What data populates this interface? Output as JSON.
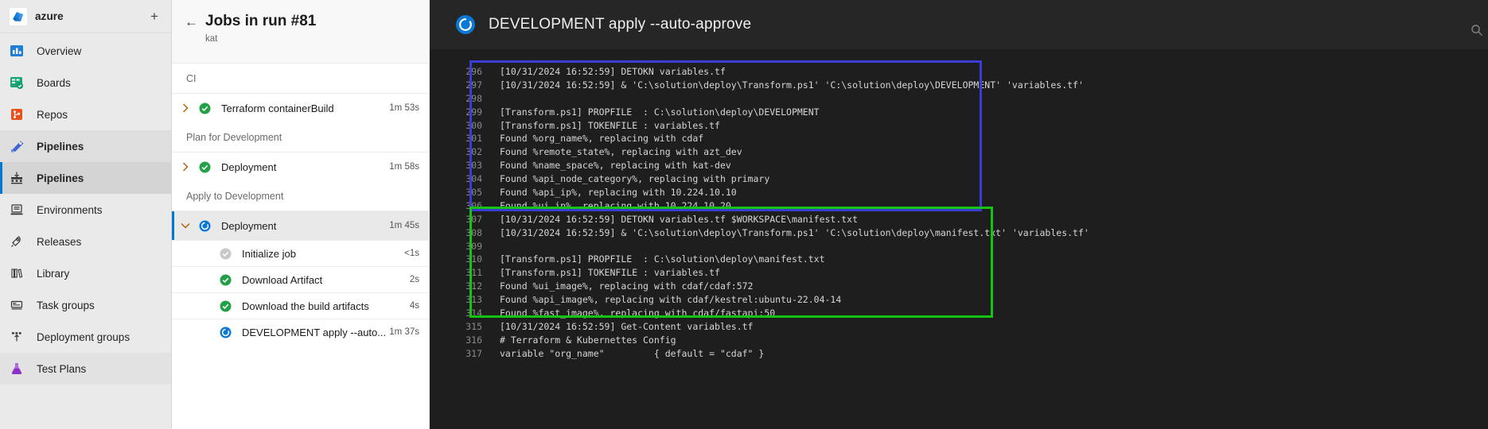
{
  "nav": {
    "org_name": "azure",
    "add_label": "+",
    "items": [
      {
        "label": "Overview",
        "icon": "overview-icon",
        "state": "normal"
      },
      {
        "label": "Boards",
        "icon": "boards-icon",
        "state": "normal"
      },
      {
        "label": "Repos",
        "icon": "repos-icon",
        "state": "normal"
      },
      {
        "label": "Pipelines",
        "icon": "pipelines-icon",
        "state": "group"
      },
      {
        "label": "Pipelines",
        "icon": "pipelines-sub-icon",
        "state": "active"
      },
      {
        "label": "Environments",
        "icon": "environments-icon",
        "state": "normal"
      },
      {
        "label": "Releases",
        "icon": "releases-icon",
        "state": "normal"
      },
      {
        "label": "Library",
        "icon": "library-icon",
        "state": "normal"
      },
      {
        "label": "Task groups",
        "icon": "task-groups-icon",
        "state": "normal"
      },
      {
        "label": "Deployment groups",
        "icon": "deployment-groups-icon",
        "state": "normal"
      },
      {
        "label": "Test Plans",
        "icon": "test-plans-icon",
        "state": "testplans"
      }
    ]
  },
  "jobs_panel": {
    "back_label": "←",
    "title": "Jobs in run #81",
    "subtitle": "kat",
    "sections": [
      {
        "stage": "CI",
        "rows": [
          {
            "kind": "job",
            "name": "Terraform containerBuild",
            "duration": "1m 53s",
            "status": "succeeded",
            "expanded": false,
            "selected": false
          }
        ]
      },
      {
        "stage": "Plan for Development",
        "rows": [
          {
            "kind": "job",
            "name": "Deployment",
            "duration": "1m 58s",
            "status": "succeeded",
            "expanded": false,
            "selected": false
          }
        ]
      },
      {
        "stage": "Apply to Development",
        "rows": [
          {
            "kind": "job",
            "name": "Deployment",
            "duration": "1m 45s",
            "status": "running",
            "expanded": true,
            "selected": true
          },
          {
            "kind": "task",
            "name": "Initialize job",
            "duration": "<1s",
            "status": "skipped"
          },
          {
            "kind": "task",
            "name": "Download Artifact",
            "duration": "2s",
            "status": "succeeded"
          },
          {
            "kind": "task",
            "name": "Download the build artifacts",
            "duration": "4s",
            "status": "succeeded"
          },
          {
            "kind": "task",
            "name": "DEVELOPMENT apply --auto...",
            "duration": "1m 37s",
            "status": "running"
          }
        ]
      }
    ]
  },
  "log_panel": {
    "title": "DEVELOPMENT apply --auto-approve",
    "status_icon": "running-spinner-icon",
    "search_icon": "search-icon",
    "lines": [
      {
        "n": "296",
        "text": "[10/31/2024 16:52:59] DETOKN variables.tf"
      },
      {
        "n": "297",
        "text": "[10/31/2024 16:52:59] & 'C:\\solution\\deploy\\Transform.ps1' 'C:\\solution\\deploy\\DEVELOPMENT' 'variables.tf'"
      },
      {
        "n": "298",
        "text": ""
      },
      {
        "n": "299",
        "text": "[Transform.ps1] PROPFILE  : C:\\solution\\deploy\\DEVELOPMENT"
      },
      {
        "n": "300",
        "text": "[Transform.ps1] TOKENFILE : variables.tf"
      },
      {
        "n": "301",
        "text": "Found %org_name%, replacing with cdaf"
      },
      {
        "n": "302",
        "text": "Found %remote_state%, replacing with azt_dev"
      },
      {
        "n": "303",
        "text": "Found %name_space%, replacing with kat-dev"
      },
      {
        "n": "304",
        "text": "Found %api_node_category%, replacing with primary"
      },
      {
        "n": "305",
        "text": "Found %api_ip%, replacing with 10.224.10.10"
      },
      {
        "n": "306",
        "text": "Found %ui_ip%, replacing with 10.224.10.20"
      },
      {
        "n": "307",
        "text": "[10/31/2024 16:52:59] DETOKN variables.tf $WORKSPACE\\manifest.txt"
      },
      {
        "n": "308",
        "text": "[10/31/2024 16:52:59] & 'C:\\solution\\deploy\\Transform.ps1' 'C:\\solution\\deploy\\manifest.txt' 'variables.tf'"
      },
      {
        "n": "309",
        "text": ""
      },
      {
        "n": "310",
        "text": "[Transform.ps1] PROPFILE  : C:\\solution\\deploy\\manifest.txt"
      },
      {
        "n": "311",
        "text": "[Transform.ps1] TOKENFILE : variables.tf"
      },
      {
        "n": "312",
        "text": "Found %ui_image%, replacing with cdaf/cdaf:572"
      },
      {
        "n": "313",
        "text": "Found %api_image%, replacing with cdaf/kestrel:ubuntu-22.04-14"
      },
      {
        "n": "314",
        "text": "Found %fast_image%, replacing with cdaf/fastapi:50"
      },
      {
        "n": "315",
        "text": "[10/31/2024 16:52:59] Get-Content variables.tf"
      },
      {
        "n": "316",
        "text": "# Terraform & Kubernettes Config"
      },
      {
        "n": "317",
        "text": "variable \"org_name\"         { default = \"cdaf\" }"
      }
    ],
    "highlights": [
      {
        "name": "blue-annotation-box",
        "color": "#3b3bd6",
        "from_line": "296",
        "to_line": "306"
      },
      {
        "name": "green-annotation-box",
        "color": "#13c413",
        "from_line": "307",
        "to_line": "314"
      }
    ]
  }
}
